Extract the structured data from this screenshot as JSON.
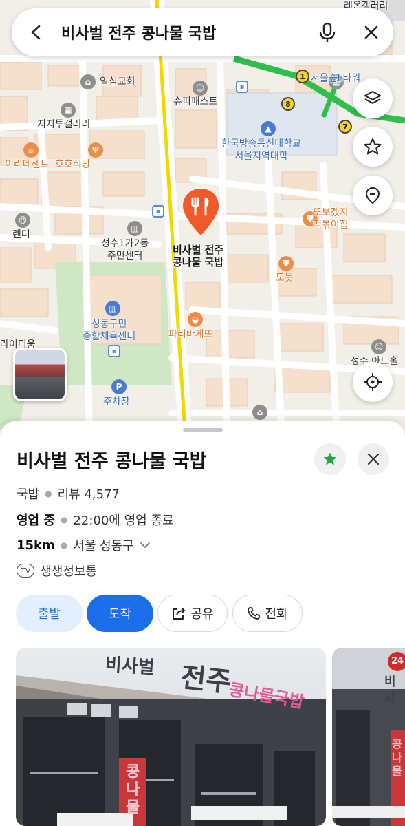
{
  "search": {
    "query": "비사벌 전주 콩나물 국밥"
  },
  "map": {
    "labels": {
      "ilsin": "일심교회",
      "supermarket": "슈퍼패스트",
      "jijitu": "지지투갤러리",
      "iride": "이리데센트",
      "hoho": "호호식당",
      "render": "렌더",
      "seongsu_office": "성수1가2동\n주민센터",
      "target_name": "비사벌 전주\n콩나물 국밥",
      "univ": "한국방송통신대학교\n서울지역대학",
      "forest": "서울숲L타워",
      "ttobo": "또보겠지\n떡볶이집",
      "dodot": "도돗",
      "paris": "파리바게뜨",
      "gym": "성동구민\n종합체육센터",
      "parking": "주차장",
      "rei": "레온갤러리",
      "lightium": "라이티움",
      "seongsu_art": "성수 아트홀"
    },
    "stations": [
      "1",
      "8",
      "7"
    ],
    "colors": {
      "road_main": "#f1d800",
      "subway": "#2fbf4a",
      "pin": "#f05a28",
      "park": "#cfe7c4"
    }
  },
  "place": {
    "title": "비사벌 전주 콩나물 국밥",
    "category": "국밥",
    "review_label": "리뷰 4,577",
    "status": "영업 중",
    "hours": "22:00에 영업 종료",
    "distance": "15km",
    "address": "서울 성동구",
    "tv_badge": "TV",
    "tv_show": "생생정보통"
  },
  "actions": {
    "depart": "출발",
    "arrive": "도착",
    "share": "공유",
    "call": "전화"
  },
  "photos": {
    "sign_main_left": "비사벌",
    "sign_main_right": "전주",
    "sign_main_pink": "콩나물국밥",
    "vertical_sign": "콩나물",
    "side_sign": "비사",
    "side_badge": "24",
    "side_vertical": "콩나물"
  },
  "accent_colors": {
    "primary": "#1a6fe8",
    "primary_light": "#e3effd",
    "star": "#1fa83f"
  }
}
